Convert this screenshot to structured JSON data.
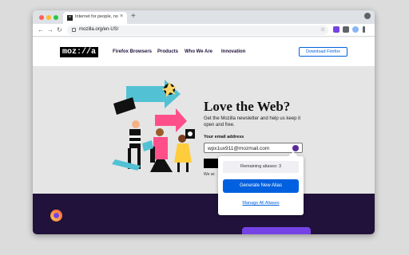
{
  "browser": {
    "tab_title": "Internet for people, not profit",
    "tab_favicon": "m",
    "url": "mozilla.org/en-US/",
    "new_tab": "+",
    "close": "×"
  },
  "site": {
    "logo": "moz://a",
    "nav": [
      "Firefox Browsers",
      "Products",
      "Who We Are",
      "Innovation"
    ],
    "download_button": "Download Firefox"
  },
  "hero": {
    "title": "Love the Web?",
    "text": "Get the Mozilla newsletter and help us keep it open and free.",
    "email_label": "Your email address",
    "email_value": "wpx1ux911@mozmail.com",
    "below_text": "We wi"
  },
  "popup": {
    "remaining": "Remaining aliases: 3",
    "generate": "Generate New Alias",
    "manage": "Manage All Aliases"
  },
  "colors": {
    "accent": "#0060df",
    "footer": "#20123a",
    "brand_purple": "#7542e5"
  }
}
